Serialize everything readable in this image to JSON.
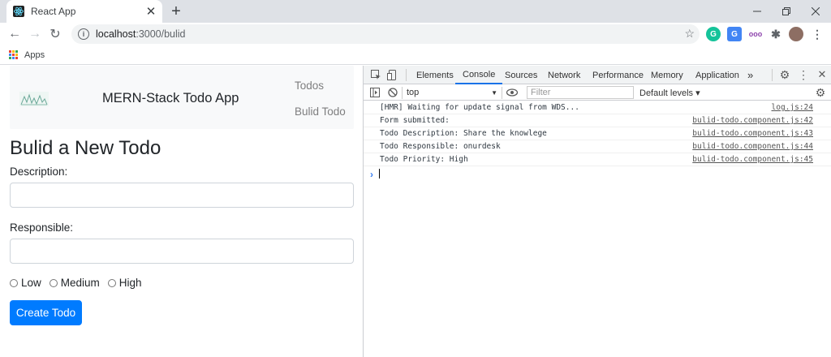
{
  "browser": {
    "tab_title": "React App",
    "url_host": "localhost",
    "url_path": ":3000/bulid",
    "bookmarks_label": "Apps"
  },
  "app": {
    "brand": "MERN-Stack Todo App",
    "nav": [
      "Todos",
      "Bulid Todo"
    ],
    "page_title": "Bulid a New Todo",
    "description_label": "Description:",
    "responsible_label": "Responsible:",
    "priorities": [
      "Low",
      "Medium",
      "High"
    ],
    "create_button": "Create Todo"
  },
  "devtools": {
    "tabs": [
      "Elements",
      "Console",
      "Sources",
      "Network",
      "Performance",
      "Memory",
      "Application"
    ],
    "active_tab": "Console",
    "more_tabs": "»",
    "context": "top",
    "filter_placeholder": "Filter",
    "levels": "Default levels ▾",
    "logs": [
      {
        "msg": "[HMR] Waiting for update signal from WDS...",
        "src": "log.js:24"
      },
      {
        "msg": "Form submitted:",
        "src": "bulid-todo.component.js:42"
      },
      {
        "msg": "Todo Description: Share the knowlege",
        "src": "bulid-todo.component.js:43"
      },
      {
        "msg": "Todo Responsible: onurdesk",
        "src": "bulid-todo.component.js:44"
      },
      {
        "msg": "Todo Priority: High",
        "src": "bulid-todo.component.js:45"
      }
    ],
    "prompt": "›"
  },
  "colors": {
    "accent": "#1a73e8",
    "primary_button": "#007bff",
    "tabbar": "#dee1e6"
  }
}
